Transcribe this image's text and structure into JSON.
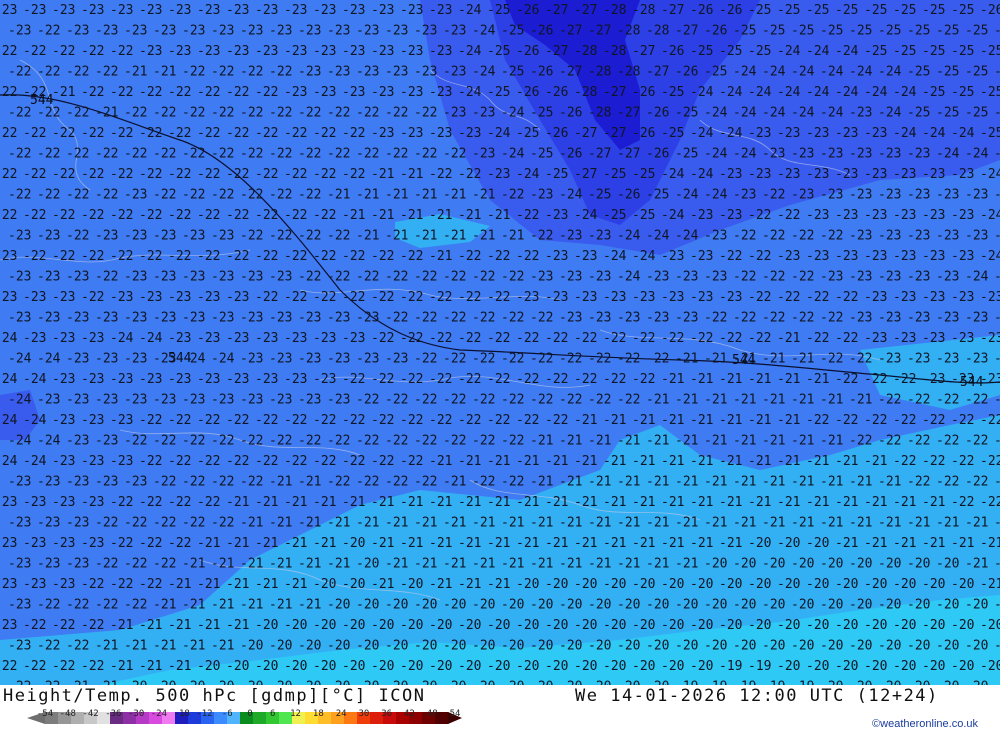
{
  "map": {
    "title": "Height/Temp. 500 hPc [gdmp][°C] ICON",
    "datetime": "We 14-01-2026 12:00 UTC (12+24)",
    "credit": "©weatheronline.co.uk",
    "contour_label": "544",
    "temperature_zones": [
      {
        "value": "-28",
        "color": "#1c1cd2"
      },
      {
        "value": "-26",
        "color": "#2d40e6"
      },
      {
        "value": "-24",
        "color": "#3a5cee"
      },
      {
        "value": "-22",
        "color": "#3f7bf2"
      },
      {
        "value": "-20",
        "color": "#33b0f4"
      },
      {
        "value": "-18",
        "color": "#2fc9f5"
      }
    ],
    "legend": {
      "ticks": [
        "-54",
        "-48",
        "-42",
        "-36",
        "-30",
        "-24",
        "-18",
        "-12",
        "-6",
        "0",
        "6",
        "12",
        "18",
        "24",
        "30",
        "36",
        "42",
        "48",
        "54"
      ],
      "colors": [
        "#7d7d7d",
        "#969696",
        "#afafaf",
        "#c8c8c8",
        "#e1e1e1",
        "#6a2b82",
        "#8e2fa5",
        "#b53ac6",
        "#d94ae0",
        "#f07af0",
        "#1e1ebe",
        "#1e3cdc",
        "#2864f0",
        "#3c8cff",
        "#50b4ff",
        "#0a8c1e",
        "#1eaa28",
        "#32c832",
        "#50e650",
        "#f0f050",
        "#ffdc32",
        "#ffbe28",
        "#ffa01e",
        "#ff7814",
        "#f03c0a",
        "#dc1e0a",
        "#c80a0a",
        "#aa0000",
        "#8c0000",
        "#6e0000",
        "#500000"
      ]
    },
    "rows": [
      [
        "-23",
        "-23",
        "-23",
        "-23",
        "-23",
        "-23",
        "-23",
        "-23",
        "-23",
        "-23",
        "-23",
        "-23",
        "-23",
        "-23",
        "-23",
        "-23",
        "-24",
        "-25",
        "-26",
        "-27",
        "-27",
        "-28",
        "-28",
        "-27",
        "-26",
        "-26",
        "-25",
        "-25",
        "-25",
        "-25",
        "-25",
        "-25",
        "-25",
        "-25",
        "-26"
      ],
      [
        "-23",
        "-22",
        "-23",
        "-23",
        "-23",
        "-23",
        "-23",
        "-23",
        "-23",
        "-23",
        "-23",
        "-23",
        "-23",
        "-23",
        "-23",
        "-23",
        "-24",
        "-25",
        "-26",
        "-27",
        "-27",
        "-28",
        "-28",
        "-27",
        "-26",
        "-25",
        "-25",
        "-25",
        "-25",
        "-25",
        "-25",
        "-25",
        "-25",
        "-25",
        "-25"
      ],
      [
        "-22",
        "-22",
        "-22",
        "-22",
        "-22",
        "-23",
        "-23",
        "-23",
        "-23",
        "-23",
        "-23",
        "-23",
        "-23",
        "-23",
        "-23",
        "-23",
        "-24",
        "-25",
        "-26",
        "-27",
        "-28",
        "-28",
        "-27",
        "-26",
        "-25",
        "-25",
        "-25",
        "-24",
        "-24",
        "-24",
        "-25",
        "-25",
        "-25",
        "-25",
        "-25"
      ],
      [
        "-22",
        "-22",
        "-22",
        "-22",
        "-21",
        "-21",
        "-22",
        "-22",
        "-22",
        "-22",
        "-23",
        "-23",
        "-23",
        "-23",
        "-23",
        "-23",
        "-24",
        "-25",
        "-26",
        "-27",
        "-28",
        "-28",
        "-27",
        "-26",
        "-25",
        "-24",
        "-24",
        "-24",
        "-24",
        "-24",
        "-24",
        "-25",
        "-25",
        "-25",
        "-25"
      ],
      [
        "-22",
        "-22",
        "-21",
        "-22",
        "-22",
        "-22",
        "-22",
        "-22",
        "-22",
        "-22",
        "-23",
        "-23",
        "-23",
        "-23",
        "-23",
        "-23",
        "-24",
        "-25",
        "-26",
        "-26",
        "-28",
        "-27",
        "-26",
        "-25",
        "-24",
        "-24",
        "-24",
        "-24",
        "-24",
        "-24",
        "-24",
        "-24",
        "-25",
        "-25",
        "-25"
      ],
      [
        "-22",
        "-22",
        "-22",
        "-21",
        "-22",
        "-22",
        "-22",
        "-22",
        "-22",
        "-22",
        "-22",
        "-22",
        "-22",
        "-22",
        "-22",
        "-23",
        "-23",
        "-24",
        "-25",
        "-26",
        "-28",
        "-27",
        "-26",
        "-25",
        "-24",
        "-24",
        "-24",
        "-24",
        "-24",
        "-23",
        "-24",
        "-25",
        "-25",
        "-25",
        "-25"
      ],
      [
        "-22",
        "-22",
        "-22",
        "-22",
        "-22",
        "-22",
        "-22",
        "-22",
        "-22",
        "-22",
        "-22",
        "-22",
        "-22",
        "-23",
        "-23",
        "-23",
        "-23",
        "-24",
        "-25",
        "-26",
        "-27",
        "-27",
        "-26",
        "-25",
        "-24",
        "-24",
        "-23",
        "-23",
        "-23",
        "-23",
        "-23",
        "-24",
        "-24",
        "-24",
        "-25"
      ],
      [
        "-22",
        "-22",
        "-22",
        "-22",
        "-22",
        "-22",
        "-22",
        "-22",
        "-22",
        "-22",
        "-22",
        "-22",
        "-22",
        "-22",
        "-22",
        "-22",
        "-23",
        "-24",
        "-25",
        "-26",
        "-27",
        "-27",
        "-26",
        "-25",
        "-24",
        "-24",
        "-23",
        "-23",
        "-23",
        "-23",
        "-23",
        "-23",
        "-24",
        "-24",
        "-24"
      ],
      [
        "-22",
        "-22",
        "-22",
        "-22",
        "-22",
        "-22",
        "-22",
        "-22",
        "-22",
        "-22",
        "-22",
        "-22",
        "-22",
        "-21",
        "-21",
        "-22",
        "-22",
        "-23",
        "-24",
        "-25",
        "-27",
        "-25",
        "-25",
        "-24",
        "-24",
        "-23",
        "-23",
        "-23",
        "-23",
        "-23",
        "-23",
        "-23",
        "-23",
        "-23",
        "-24"
      ],
      [
        "-22",
        "-22",
        "-22",
        "-22",
        "-23",
        "-22",
        "-22",
        "-22",
        "-22",
        "-22",
        "-22",
        "-21",
        "-21",
        "-21",
        "-21",
        "-21",
        "-21",
        "-22",
        "-23",
        "-24",
        "-25",
        "-26",
        "-25",
        "-24",
        "-24",
        "-23",
        "-22",
        "-23",
        "-23",
        "-23",
        "-23",
        "-23",
        "-23",
        "-23",
        "-24"
      ],
      [
        "-22",
        "-22",
        "-22",
        "-22",
        "-22",
        "-22",
        "-22",
        "-22",
        "-22",
        "-22",
        "-22",
        "-22",
        "-21",
        "-21",
        "-21",
        "-21",
        "-21",
        "-21",
        "-22",
        "-23",
        "-24",
        "-25",
        "-25",
        "-24",
        "-23",
        "-23",
        "-22",
        "-22",
        "-23",
        "-23",
        "-23",
        "-23",
        "-23",
        "-23",
        "-24"
      ],
      [
        "-23",
        "-23",
        "-22",
        "-23",
        "-23",
        "-23",
        "-23",
        "-23",
        "-22",
        "-22",
        "-22",
        "-22",
        "-21",
        "-21",
        "-21",
        "-21",
        "-21",
        "-21",
        "-22",
        "-23",
        "-23",
        "-24",
        "-24",
        "-24",
        "-23",
        "-22",
        "-22",
        "-22",
        "-22",
        "-23",
        "-23",
        "-23",
        "-23",
        "-23",
        "-24"
      ],
      [
        "-23",
        "-22",
        "-22",
        "-22",
        "-22",
        "-22",
        "-22",
        "-22",
        "-22",
        "-22",
        "-22",
        "-22",
        "-22",
        "-22",
        "-22",
        "-21",
        "-22",
        "-22",
        "-22",
        "-23",
        "-23",
        "-24",
        "-24",
        "-23",
        "-23",
        "-22",
        "-22",
        "-23",
        "-23",
        "-23",
        "-23",
        "-23",
        "-23",
        "-23",
        "-24"
      ],
      [
        "-23",
        "-23",
        "-23",
        "-22",
        "-23",
        "-23",
        "-23",
        "-23",
        "-23",
        "-23",
        "-22",
        "-22",
        "-22",
        "-22",
        "-22",
        "-22",
        "-22",
        "-22",
        "-23",
        "-23",
        "-23",
        "-24",
        "-23",
        "-23",
        "-23",
        "-22",
        "-22",
        "-22",
        "-23",
        "-23",
        "-23",
        "-23",
        "-23",
        "-24",
        "-24"
      ],
      [
        "-23",
        "-23",
        "-23",
        "-22",
        "-23",
        "-23",
        "-23",
        "-23",
        "-23",
        "-22",
        "-22",
        "-22",
        "-22",
        "-22",
        "-22",
        "-22",
        "-22",
        "-22",
        "-23",
        "-23",
        "-23",
        "-23",
        "-23",
        "-23",
        "-23",
        "-23",
        "-22",
        "-22",
        "-22",
        "-22",
        "-23",
        "-23",
        "-23",
        "-23",
        "-23"
      ],
      [
        "-23",
        "-23",
        "-23",
        "-23",
        "-23",
        "-23",
        "-23",
        "-23",
        "-23",
        "-23",
        "-23",
        "-23",
        "-23",
        "-22",
        "-22",
        "-22",
        "-22",
        "-22",
        "-22",
        "-23",
        "-23",
        "-23",
        "-23",
        "-23",
        "-22",
        "-22",
        "-22",
        "-22",
        "-22",
        "-23",
        "-23",
        "-23",
        "-23",
        "-23",
        "-23"
      ],
      [
        "-24",
        "-23",
        "-23",
        "-23",
        "-24",
        "-24",
        "-23",
        "-23",
        "-23",
        "-23",
        "-23",
        "-23",
        "-23",
        "-22",
        "-22",
        "-22",
        "-22",
        "-22",
        "-22",
        "-22",
        "-22",
        "-22",
        "-22",
        "-22",
        "-22",
        "-22",
        "-22",
        "-21",
        "-22",
        "-22",
        "-23",
        "-23",
        "-23",
        "-23",
        "-23"
      ],
      [
        "-24",
        "-24",
        "-23",
        "-23",
        "-23",
        "-23",
        "-24",
        "-24",
        "-23",
        "-23",
        "-23",
        "-23",
        "-23",
        "-23",
        "-22",
        "-22",
        "-22",
        "-22",
        "-22",
        "-22",
        "-22",
        "-22",
        "-22",
        "-21",
        "-21",
        "-21",
        "-21",
        "-21",
        "-22",
        "-22",
        "-23",
        "-23",
        "-23",
        "-23",
        "-23"
      ],
      [
        "-24",
        "-24",
        "-23",
        "-23",
        "-23",
        "-23",
        "-23",
        "-23",
        "-23",
        "-23",
        "-23",
        "-23",
        "-22",
        "-22",
        "-22",
        "-22",
        "-22",
        "-22",
        "-22",
        "-22",
        "-22",
        "-22",
        "-22",
        "-21",
        "-21",
        "-21",
        "-21",
        "-21",
        "-21",
        "-22",
        "-22",
        "-22",
        "-23",
        "-23",
        "-23"
      ],
      [
        "-24",
        "-23",
        "-23",
        "-23",
        "-23",
        "-23",
        "-23",
        "-23",
        "-23",
        "-23",
        "-23",
        "-23",
        "-22",
        "-22",
        "-22",
        "-22",
        "-22",
        "-22",
        "-22",
        "-22",
        "-22",
        "-22",
        "-21",
        "-21",
        "-21",
        "-21",
        "-21",
        "-21",
        "-21",
        "-21",
        "-22",
        "-22",
        "-22",
        "-22",
        "-22"
      ],
      [
        "-24",
        "-24",
        "-23",
        "-23",
        "-23",
        "-22",
        "-22",
        "-22",
        "-22",
        "-22",
        "-22",
        "-22",
        "-22",
        "-22",
        "-22",
        "-22",
        "-22",
        "-22",
        "-22",
        "-22",
        "-21",
        "-21",
        "-21",
        "-21",
        "-21",
        "-21",
        "-21",
        "-21",
        "-22",
        "-22",
        "-22",
        "-22",
        "-22",
        "-22",
        "-22"
      ],
      [
        "-24",
        "-24",
        "-23",
        "-23",
        "-22",
        "-22",
        "-22",
        "-22",
        "-22",
        "-22",
        "-22",
        "-22",
        "-22",
        "-22",
        "-22",
        "-22",
        "-22",
        "-22",
        "-21",
        "-21",
        "-21",
        "-21",
        "-21",
        "-21",
        "-21",
        "-21",
        "-21",
        "-21",
        "-21",
        "-22",
        "-22",
        "-22",
        "-22",
        "-22",
        "-22"
      ],
      [
        "-24",
        "-24",
        "-23",
        "-23",
        "-23",
        "-22",
        "-22",
        "-22",
        "-22",
        "-22",
        "-22",
        "-22",
        "-22",
        "-22",
        "-22",
        "-21",
        "-21",
        "-21",
        "-21",
        "-21",
        "-21",
        "-21",
        "-21",
        "-21",
        "-21",
        "-21",
        "-21",
        "-21",
        "-21",
        "-21",
        "-21",
        "-22",
        "-22",
        "-22",
        "-22"
      ],
      [
        "-23",
        "-23",
        "-23",
        "-23",
        "-23",
        "-22",
        "-22",
        "-22",
        "-22",
        "-21",
        "-21",
        "-22",
        "-22",
        "-22",
        "-22",
        "-21",
        "-22",
        "-22",
        "-21",
        "-21",
        "-21",
        "-21",
        "-21",
        "-21",
        "-21",
        "-21",
        "-21",
        "-21",
        "-21",
        "-21",
        "-21",
        "-22",
        "-22",
        "-22",
        "-22"
      ],
      [
        "-23",
        "-23",
        "-23",
        "-23",
        "-22",
        "-22",
        "-22",
        "-22",
        "-21",
        "-21",
        "-21",
        "-21",
        "-21",
        "-21",
        "-21",
        "-21",
        "-21",
        "-21",
        "-21",
        "-21",
        "-21",
        "-21",
        "-21",
        "-21",
        "-21",
        "-21",
        "-21",
        "-21",
        "-21",
        "-21",
        "-21",
        "-21",
        "-21",
        "-22",
        "-22"
      ],
      [
        "-23",
        "-23",
        "-23",
        "-22",
        "-22",
        "-22",
        "-22",
        "-22",
        "-21",
        "-21",
        "-21",
        "-21",
        "-21",
        "-21",
        "-21",
        "-21",
        "-21",
        "-21",
        "-21",
        "-21",
        "-21",
        "-21",
        "-21",
        "-21",
        "-21",
        "-21",
        "-21",
        "-21",
        "-21",
        "-21",
        "-21",
        "-21",
        "-21",
        "-21",
        "-21"
      ],
      [
        "-23",
        "-23",
        "-23",
        "-23",
        "-22",
        "-22",
        "-22",
        "-21",
        "-21",
        "-21",
        "-21",
        "-21",
        "-20",
        "-21",
        "-21",
        "-21",
        "-21",
        "-21",
        "-21",
        "-21",
        "-21",
        "-21",
        "-21",
        "-21",
        "-21",
        "-21",
        "-20",
        "-20",
        "-20",
        "-21",
        "-21",
        "-21",
        "-21",
        "-21",
        "-21"
      ],
      [
        "-23",
        "-23",
        "-23",
        "-22",
        "-22",
        "-22",
        "-21",
        "-21",
        "-21",
        "-21",
        "-21",
        "-21",
        "-20",
        "-21",
        "-21",
        "-21",
        "-21",
        "-21",
        "-21",
        "-21",
        "-21",
        "-21",
        "-21",
        "-21",
        "-20",
        "-20",
        "-20",
        "-20",
        "-20",
        "-20",
        "-20",
        "-20",
        "-20",
        "-21",
        "-21"
      ],
      [
        "-23",
        "-23",
        "-23",
        "-22",
        "-22",
        "-22",
        "-21",
        "-21",
        "-21",
        "-21",
        "-21",
        "-20",
        "-20",
        "-21",
        "-20",
        "-21",
        "-21",
        "-21",
        "-20",
        "-20",
        "-20",
        "-20",
        "-20",
        "-20",
        "-20",
        "-20",
        "-20",
        "-20",
        "-20",
        "-20",
        "-20",
        "-20",
        "-20",
        "-20",
        "-21"
      ],
      [
        "-23",
        "-22",
        "-22",
        "-22",
        "-22",
        "-21",
        "-21",
        "-21",
        "-21",
        "-21",
        "-21",
        "-20",
        "-20",
        "-20",
        "-20",
        "-20",
        "-20",
        "-20",
        "-20",
        "-20",
        "-20",
        "-20",
        "-20",
        "-20",
        "-20",
        "-20",
        "-20",
        "-20",
        "-20",
        "-20",
        "-20",
        "-20",
        "-20",
        "-20",
        "-20"
      ],
      [
        "-23",
        "-22",
        "-22",
        "-22",
        "-21",
        "-21",
        "-21",
        "-21",
        "-21",
        "-20",
        "-20",
        "-20",
        "-20",
        "-20",
        "-20",
        "-20",
        "-20",
        "-20",
        "-20",
        "-20",
        "-20",
        "-20",
        "-20",
        "-20",
        "-20",
        "-20",
        "-20",
        "-20",
        "-20",
        "-20",
        "-20",
        "-20",
        "-20",
        "-20",
        "-20"
      ],
      [
        "-23",
        "-22",
        "-22",
        "-21",
        "-21",
        "-21",
        "-21",
        "-21",
        "-20",
        "-20",
        "-20",
        "-20",
        "-20",
        "-20",
        "-20",
        "-20",
        "-20",
        "-20",
        "-20",
        "-20",
        "-20",
        "-20",
        "-20",
        "-20",
        "-20",
        "-20",
        "-20",
        "-20",
        "-20",
        "-20",
        "-20",
        "-20",
        "-20",
        "-20",
        "-20"
      ],
      [
        "-22",
        "-22",
        "-22",
        "-22",
        "-21",
        "-21",
        "-21",
        "-20",
        "-20",
        "-20",
        "-20",
        "-20",
        "-20",
        "-20",
        "-20",
        "-20",
        "-20",
        "-20",
        "-20",
        "-20",
        "-20",
        "-20",
        "-20",
        "-20",
        "-20",
        "-19",
        "-19",
        "-20",
        "-20",
        "-20",
        "-20",
        "-20",
        "-20",
        "-20",
        "-20"
      ],
      [
        "-22",
        "-22",
        "-21",
        "-21",
        "-20",
        "-20",
        "-20",
        "-20",
        "-20",
        "-20",
        "-20",
        "-20",
        "-20",
        "-20",
        "-20",
        "-20",
        "-20",
        "-20",
        "-20",
        "-20",
        "-20",
        "-20",
        "-20",
        "-19",
        "-19",
        "-19",
        "-19",
        "-19",
        "-20",
        "-20",
        "-20",
        "-20",
        "-20",
        "-20",
        "-20"
      ]
    ]
  }
}
